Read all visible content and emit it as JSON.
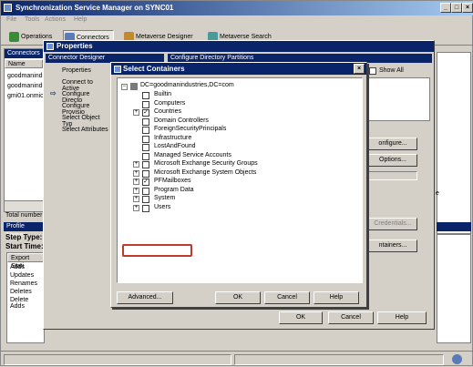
{
  "window": {
    "title": "Synchronization Service Manager on SYNC01"
  },
  "menu": [
    "File",
    "Tools",
    "Actions",
    "Help"
  ],
  "toolbar": {
    "operations": "Operations",
    "connectors": "Connectors",
    "metaverse_designer": "Metaverse Designer",
    "metaverse_search": "Metaverse Search"
  },
  "connectors_pane": {
    "header": "Connectors",
    "col_name": "Name",
    "rows": [
      "goodmanind",
      "goodmanind",
      "gmi01.onmic"
    ]
  },
  "lower_left": {
    "total_number": "Total number",
    "profile_name": "Profile Name:",
    "step_type": "Step Type:",
    "start_time": "Start Time:",
    "export_stat": "Export Stati",
    "stats": [
      "Adds",
      "Updates",
      "Renames",
      "Deletes",
      "Delete Adds"
    ]
  },
  "properties": {
    "title": "Properties",
    "designer_head": "Connector Designer",
    "partitions_head": "Configure Directory Partitions",
    "nav": [
      "Properties",
      "Connect to Active",
      "Configure Directo",
      "Configure Provisio",
      "Select Object Typ",
      "Select Attributes"
    ],
    "show_all": "Show All",
    "configure_btn": "onfigure...",
    "options_btn": "Options...",
    "credentials_btn": "Credentials...",
    "containers_btn": "ntainers...",
    "ok": "OK",
    "cancel": "Cancel",
    "help": "Help",
    "side_char": "e"
  },
  "select_containers": {
    "title": "Select Containers",
    "root": "DC=goodmanindustries,DC=com",
    "items": [
      {
        "label": "Builtin",
        "checked": false,
        "expand": false
      },
      {
        "label": "Computers",
        "checked": false,
        "expand": false
      },
      {
        "label": "Countries",
        "checked": true,
        "expand": true
      },
      {
        "label": "Domain Controllers",
        "checked": false,
        "expand": false
      },
      {
        "label": "ForeignSecurityPrincipals",
        "checked": false,
        "expand": false
      },
      {
        "label": "Infrastructure",
        "checked": false,
        "expand": false
      },
      {
        "label": "LostAndFound",
        "checked": false,
        "expand": false
      },
      {
        "label": "Managed Service Accounts",
        "checked": false,
        "expand": false
      },
      {
        "label": "Microsoft Exchange Security Groups",
        "checked": false,
        "expand": true
      },
      {
        "label": "Microsoft Exchange System Objects",
        "checked": false,
        "expand": true
      },
      {
        "label": "PFMailboxes",
        "checked": true,
        "expand": true
      },
      {
        "label": "Program Data",
        "checked": false,
        "expand": true
      },
      {
        "label": "System",
        "checked": false,
        "expand": true
      },
      {
        "label": "Users",
        "checked": false,
        "expand": true
      }
    ],
    "advanced": "Advanced...",
    "ok": "OK",
    "cancel": "Cancel",
    "help": "Help"
  }
}
